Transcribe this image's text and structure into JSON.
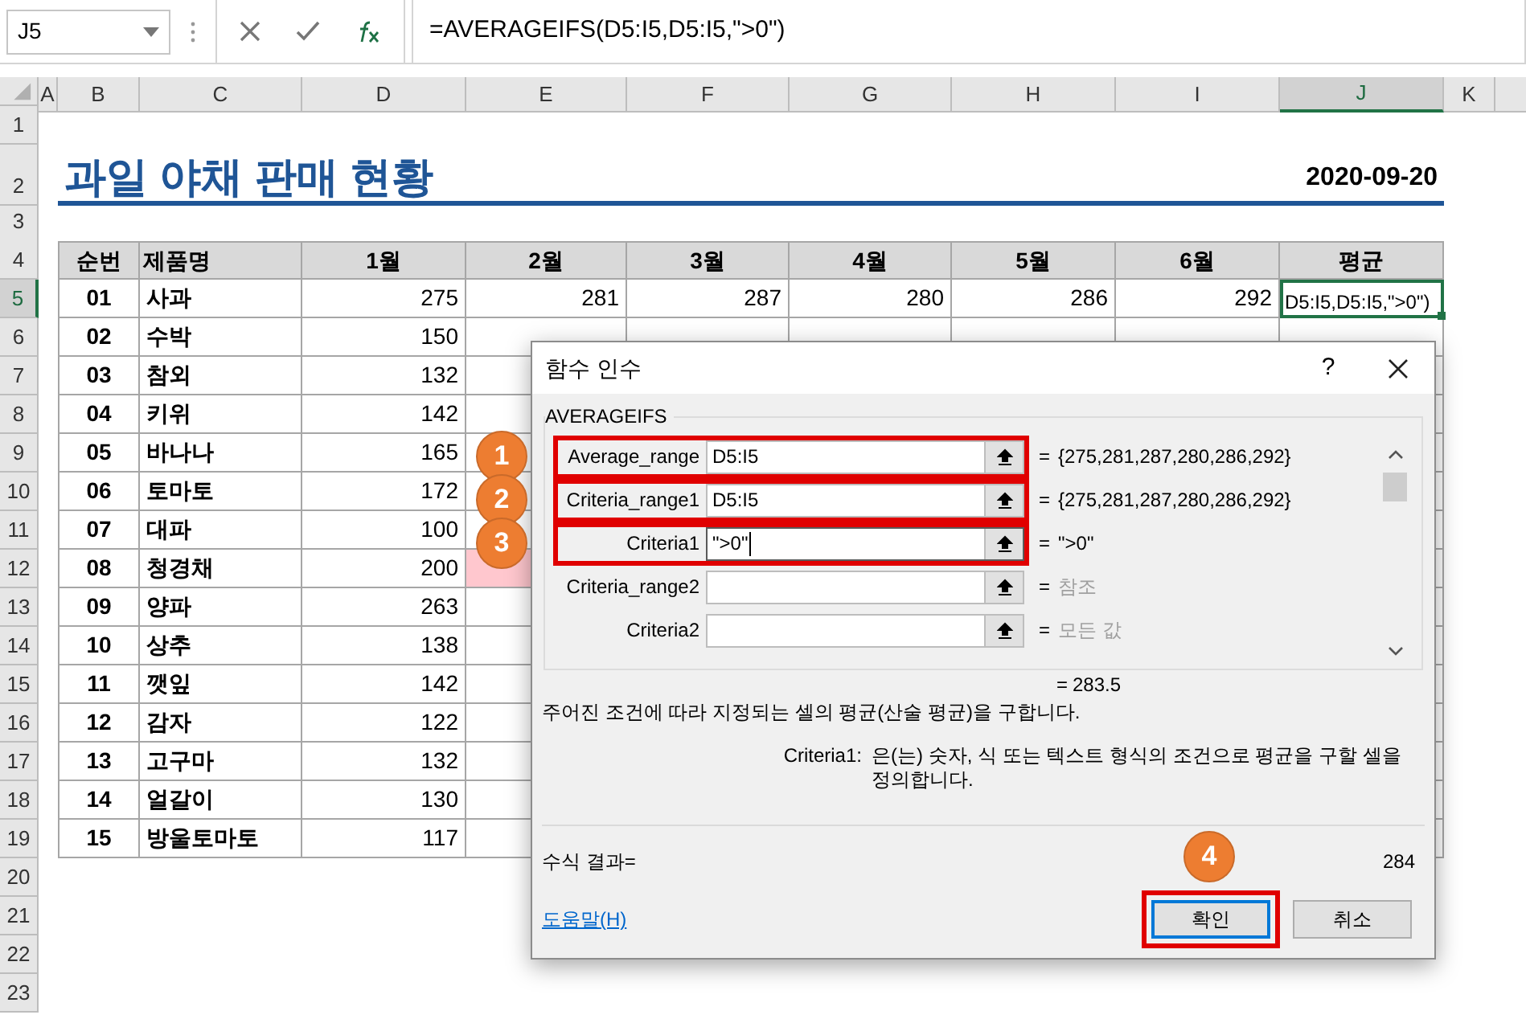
{
  "name_box": {
    "value": "J5"
  },
  "formula_bar": {
    "value": "=AVERAGEIFS(D5:I5,D5:I5,\">0\")"
  },
  "column_headers": [
    {
      "label": "A",
      "selected": false
    },
    {
      "label": "B",
      "selected": false
    },
    {
      "label": "C",
      "selected": false
    },
    {
      "label": "D",
      "selected": false
    },
    {
      "label": "E",
      "selected": false
    },
    {
      "label": "F",
      "selected": false
    },
    {
      "label": "G",
      "selected": false
    },
    {
      "label": "H",
      "selected": false
    },
    {
      "label": "I",
      "selected": false
    },
    {
      "label": "J",
      "selected": true
    },
    {
      "label": "K",
      "selected": false
    }
  ],
  "row_headers": [
    {
      "label": "1",
      "selected": false
    },
    {
      "label": "2",
      "selected": false
    },
    {
      "label": "3",
      "selected": false
    },
    {
      "label": "4",
      "selected": false
    },
    {
      "label": "5",
      "selected": true
    },
    {
      "label": "6",
      "selected": false
    },
    {
      "label": "7",
      "selected": false
    },
    {
      "label": "8",
      "selected": false
    },
    {
      "label": "9",
      "selected": false
    },
    {
      "label": "10",
      "selected": false
    },
    {
      "label": "11",
      "selected": false
    },
    {
      "label": "12",
      "selected": false
    },
    {
      "label": "13",
      "selected": false
    },
    {
      "label": "14",
      "selected": false
    },
    {
      "label": "15",
      "selected": false
    },
    {
      "label": "16",
      "selected": false
    },
    {
      "label": "17",
      "selected": false
    },
    {
      "label": "18",
      "selected": false
    },
    {
      "label": "19",
      "selected": false
    },
    {
      "label": "20",
      "selected": false
    },
    {
      "label": "21",
      "selected": false
    },
    {
      "label": "22",
      "selected": false
    },
    {
      "label": "23",
      "selected": false
    }
  ],
  "title": "과일 야채 판매 현황",
  "date": "2020-09-20",
  "table": {
    "columns": [
      "순번",
      "제품명",
      "1월",
      "2월",
      "3월",
      "4월",
      "5월",
      "6월",
      "평균"
    ],
    "rows": [
      {
        "cells": [
          "01",
          "사과",
          "275",
          "281",
          "287",
          "280",
          "286",
          "292"
        ],
        "active_cell": "D5:I5,D5:I5,\">0\")",
        "highlighted": false
      },
      {
        "cells": [
          "02",
          "수박",
          "150"
        ],
        "highlighted": false
      },
      {
        "cells": [
          "03",
          "참외",
          "132"
        ],
        "highlighted": false
      },
      {
        "cells": [
          "04",
          "키위",
          "142"
        ],
        "highlighted": false
      },
      {
        "cells": [
          "05",
          "바나나",
          "165"
        ],
        "highlighted": false
      },
      {
        "cells": [
          "06",
          "토마토",
          "172"
        ],
        "highlighted": false
      },
      {
        "cells": [
          "07",
          "대파",
          "100"
        ],
        "highlighted": false
      },
      {
        "cells": [
          "08",
          "청경채",
          "200"
        ],
        "highlighted": true
      },
      {
        "cells": [
          "09",
          "양파",
          "263"
        ],
        "highlighted": false
      },
      {
        "cells": [
          "10",
          "상추",
          "138"
        ],
        "highlighted": false
      },
      {
        "cells": [
          "11",
          "깻잎",
          "142"
        ],
        "highlighted": false
      },
      {
        "cells": [
          "12",
          "감자",
          "122"
        ],
        "highlighted": false
      },
      {
        "cells": [
          "13",
          "고구마",
          "132"
        ],
        "highlighted": false
      },
      {
        "cells": [
          "14",
          "얼갈이",
          "130"
        ],
        "highlighted": false
      },
      {
        "cells": [
          "15",
          "방울토마토",
          "117"
        ],
        "highlighted": false
      }
    ]
  },
  "dialog": {
    "title": "함수 인수",
    "help": "?",
    "function_name": "AVERAGEIFS",
    "arguments": [
      {
        "label": "Average_range",
        "value": "D5:I5",
        "sign": "=",
        "result": "{275,281,287,280,286,292}",
        "muted": false,
        "highlighted": true,
        "badge": "1",
        "focused": false
      },
      {
        "label": "Criteria_range1",
        "value": "D5:I5",
        "sign": "=",
        "result": "{275,281,287,280,286,292}",
        "muted": false,
        "highlighted": true,
        "badge": "2",
        "focused": false
      },
      {
        "label": "Criteria1",
        "value": "\">0\"",
        "sign": "=",
        "result": "\">0\"",
        "muted": false,
        "highlighted": true,
        "badge": "3",
        "focused": true
      },
      {
        "label": "Criteria_range2",
        "sign": "=",
        "result": "참조",
        "muted": true,
        "highlighted": false,
        "focused": false
      },
      {
        "label": "Criteria2",
        "sign": "=",
        "result": "모든 값",
        "muted": true,
        "highlighted": false,
        "focused": false
      }
    ],
    "total_sign": "=",
    "total": "283.5",
    "description": "주어진 조건에 따라 지정되는 셀의 평균(산술 평균)을 구합니다.",
    "param_label": "Criteria1:",
    "param_description": "은(는) 숫자, 식 또는 텍스트 형식의 조건으로 평균을 구할 셀을 정의합니다.",
    "formula_result_label": "수식 결과=",
    "formula_result": "284",
    "help_link": "도움말(H)",
    "buttons": [
      {
        "label": "확인",
        "default": true,
        "highlighted": true,
        "badge": "4"
      },
      {
        "label": "취소",
        "default": false,
        "highlighted": false
      }
    ]
  }
}
